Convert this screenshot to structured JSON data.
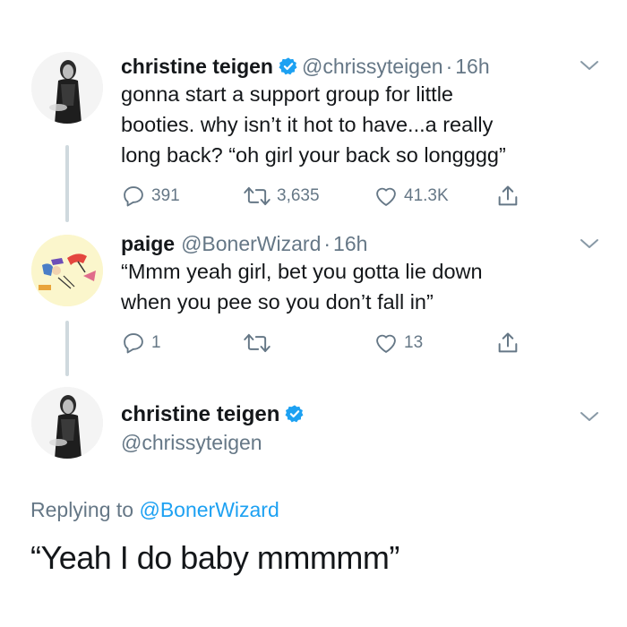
{
  "colors": {
    "accent": "#1da1f2",
    "secondary_text": "#657786",
    "line": "#cfd9de"
  },
  "tweet1": {
    "author_name": "christine teigen",
    "handle": "@chrissyteigen",
    "separator": "·",
    "time": "16h",
    "verified": true,
    "body_lines": [
      "gonna start a support group for little",
      "booties. why isn’t it hot to have...a really",
      "long back? “oh girl your back so longggg”"
    ],
    "replies": "391",
    "retweets": "3,635",
    "likes": "41.3K"
  },
  "tweet2": {
    "author_name": "paige",
    "handle": "@BonerWizard",
    "separator": "·",
    "time": "16h",
    "body_lines": [
      "“Mmm yeah girl, bet you gotta lie down",
      "when you pee so you don’t fall in”"
    ],
    "replies": "1",
    "retweets": "",
    "likes": "13"
  },
  "focus_tweet": {
    "author_name": "christine teigen",
    "handle": "@chrissyteigen",
    "verified": true,
    "replying_prefix": "Replying to",
    "replying_handle": "@BonerWizard",
    "text": "“Yeah I do baby mmmmm”"
  },
  "icons": {
    "reply": "reply-icon",
    "retweet": "retweet-icon",
    "like": "heart-icon",
    "share": "share-icon",
    "verified": "verified-badge-icon",
    "menu": "chevron-down-icon"
  }
}
